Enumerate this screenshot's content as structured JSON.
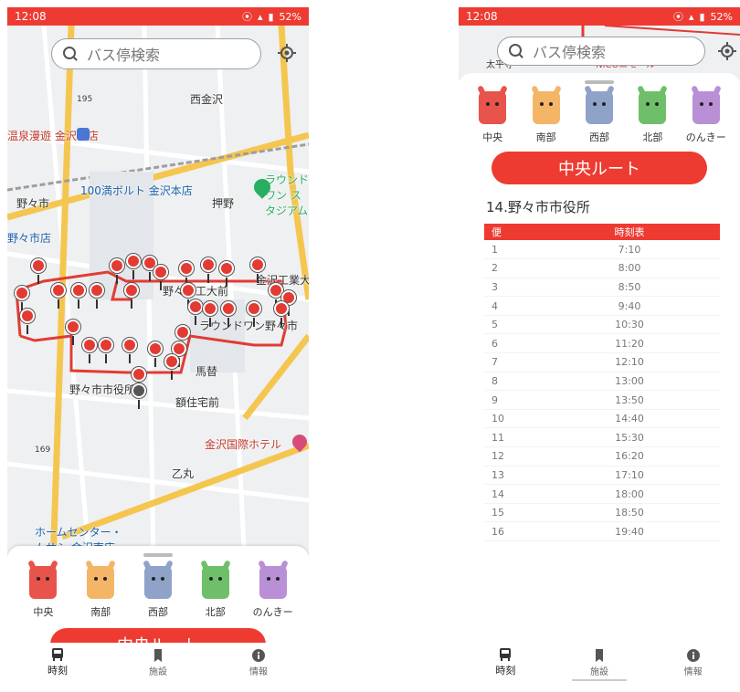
{
  "status_bar": {
    "time": "12:08",
    "battery": "52%"
  },
  "search": {
    "placeholder": "バス停検索"
  },
  "map": {
    "labels": [
      "西金沢",
      "温泉漫遊 金沢本店",
      "100満ボルト 金沢本店",
      "ラウンドワン スタジアム",
      "押野",
      "野々市",
      "野々市店",
      "金沢工業大",
      "野々市工大前",
      "ラウンドワン野々市",
      "野々市市役所",
      "馬替",
      "額住宅前",
      "金沢国際ホテル",
      "乙丸",
      "ホームセンター・ムサシ 金沢南店",
      "195",
      "169"
    ]
  },
  "areas": [
    {
      "label": "中央",
      "color": "#e8534b"
    },
    {
      "label": "南部",
      "color": "#f4b567"
    },
    {
      "label": "西部",
      "color": "#8fa3c9"
    },
    {
      "label": "北部",
      "color": "#6fbf6a"
    },
    {
      "label": "のんきー",
      "color": "#b98fd6"
    }
  ],
  "route_button": "中央ルート",
  "nav": [
    {
      "label": "時刻",
      "icon": "bus-icon"
    },
    {
      "label": "施設",
      "icon": "bookmark-icon"
    },
    {
      "label": "情報",
      "icon": "info-icon"
    }
  ],
  "timetable": {
    "map_snippet": {
      "labels": [
        "太平寺",
        "NICOニモール"
      ]
    },
    "stop_name": "14.野々市市役所",
    "headers": [
      "便",
      "時刻表"
    ],
    "rows": [
      [
        "1",
        "7:10"
      ],
      [
        "2",
        "8:00"
      ],
      [
        "3",
        "8:50"
      ],
      [
        "4",
        "9:40"
      ],
      [
        "5",
        "10:30"
      ],
      [
        "6",
        "11:20"
      ],
      [
        "7",
        "12:10"
      ],
      [
        "8",
        "13:00"
      ],
      [
        "9",
        "13:50"
      ],
      [
        "10",
        "14:40"
      ],
      [
        "11",
        "15:30"
      ],
      [
        "12",
        "16:20"
      ],
      [
        "13",
        "17:10"
      ],
      [
        "14",
        "18:00"
      ],
      [
        "15",
        "18:50"
      ],
      [
        "16",
        "19:40"
      ]
    ]
  }
}
